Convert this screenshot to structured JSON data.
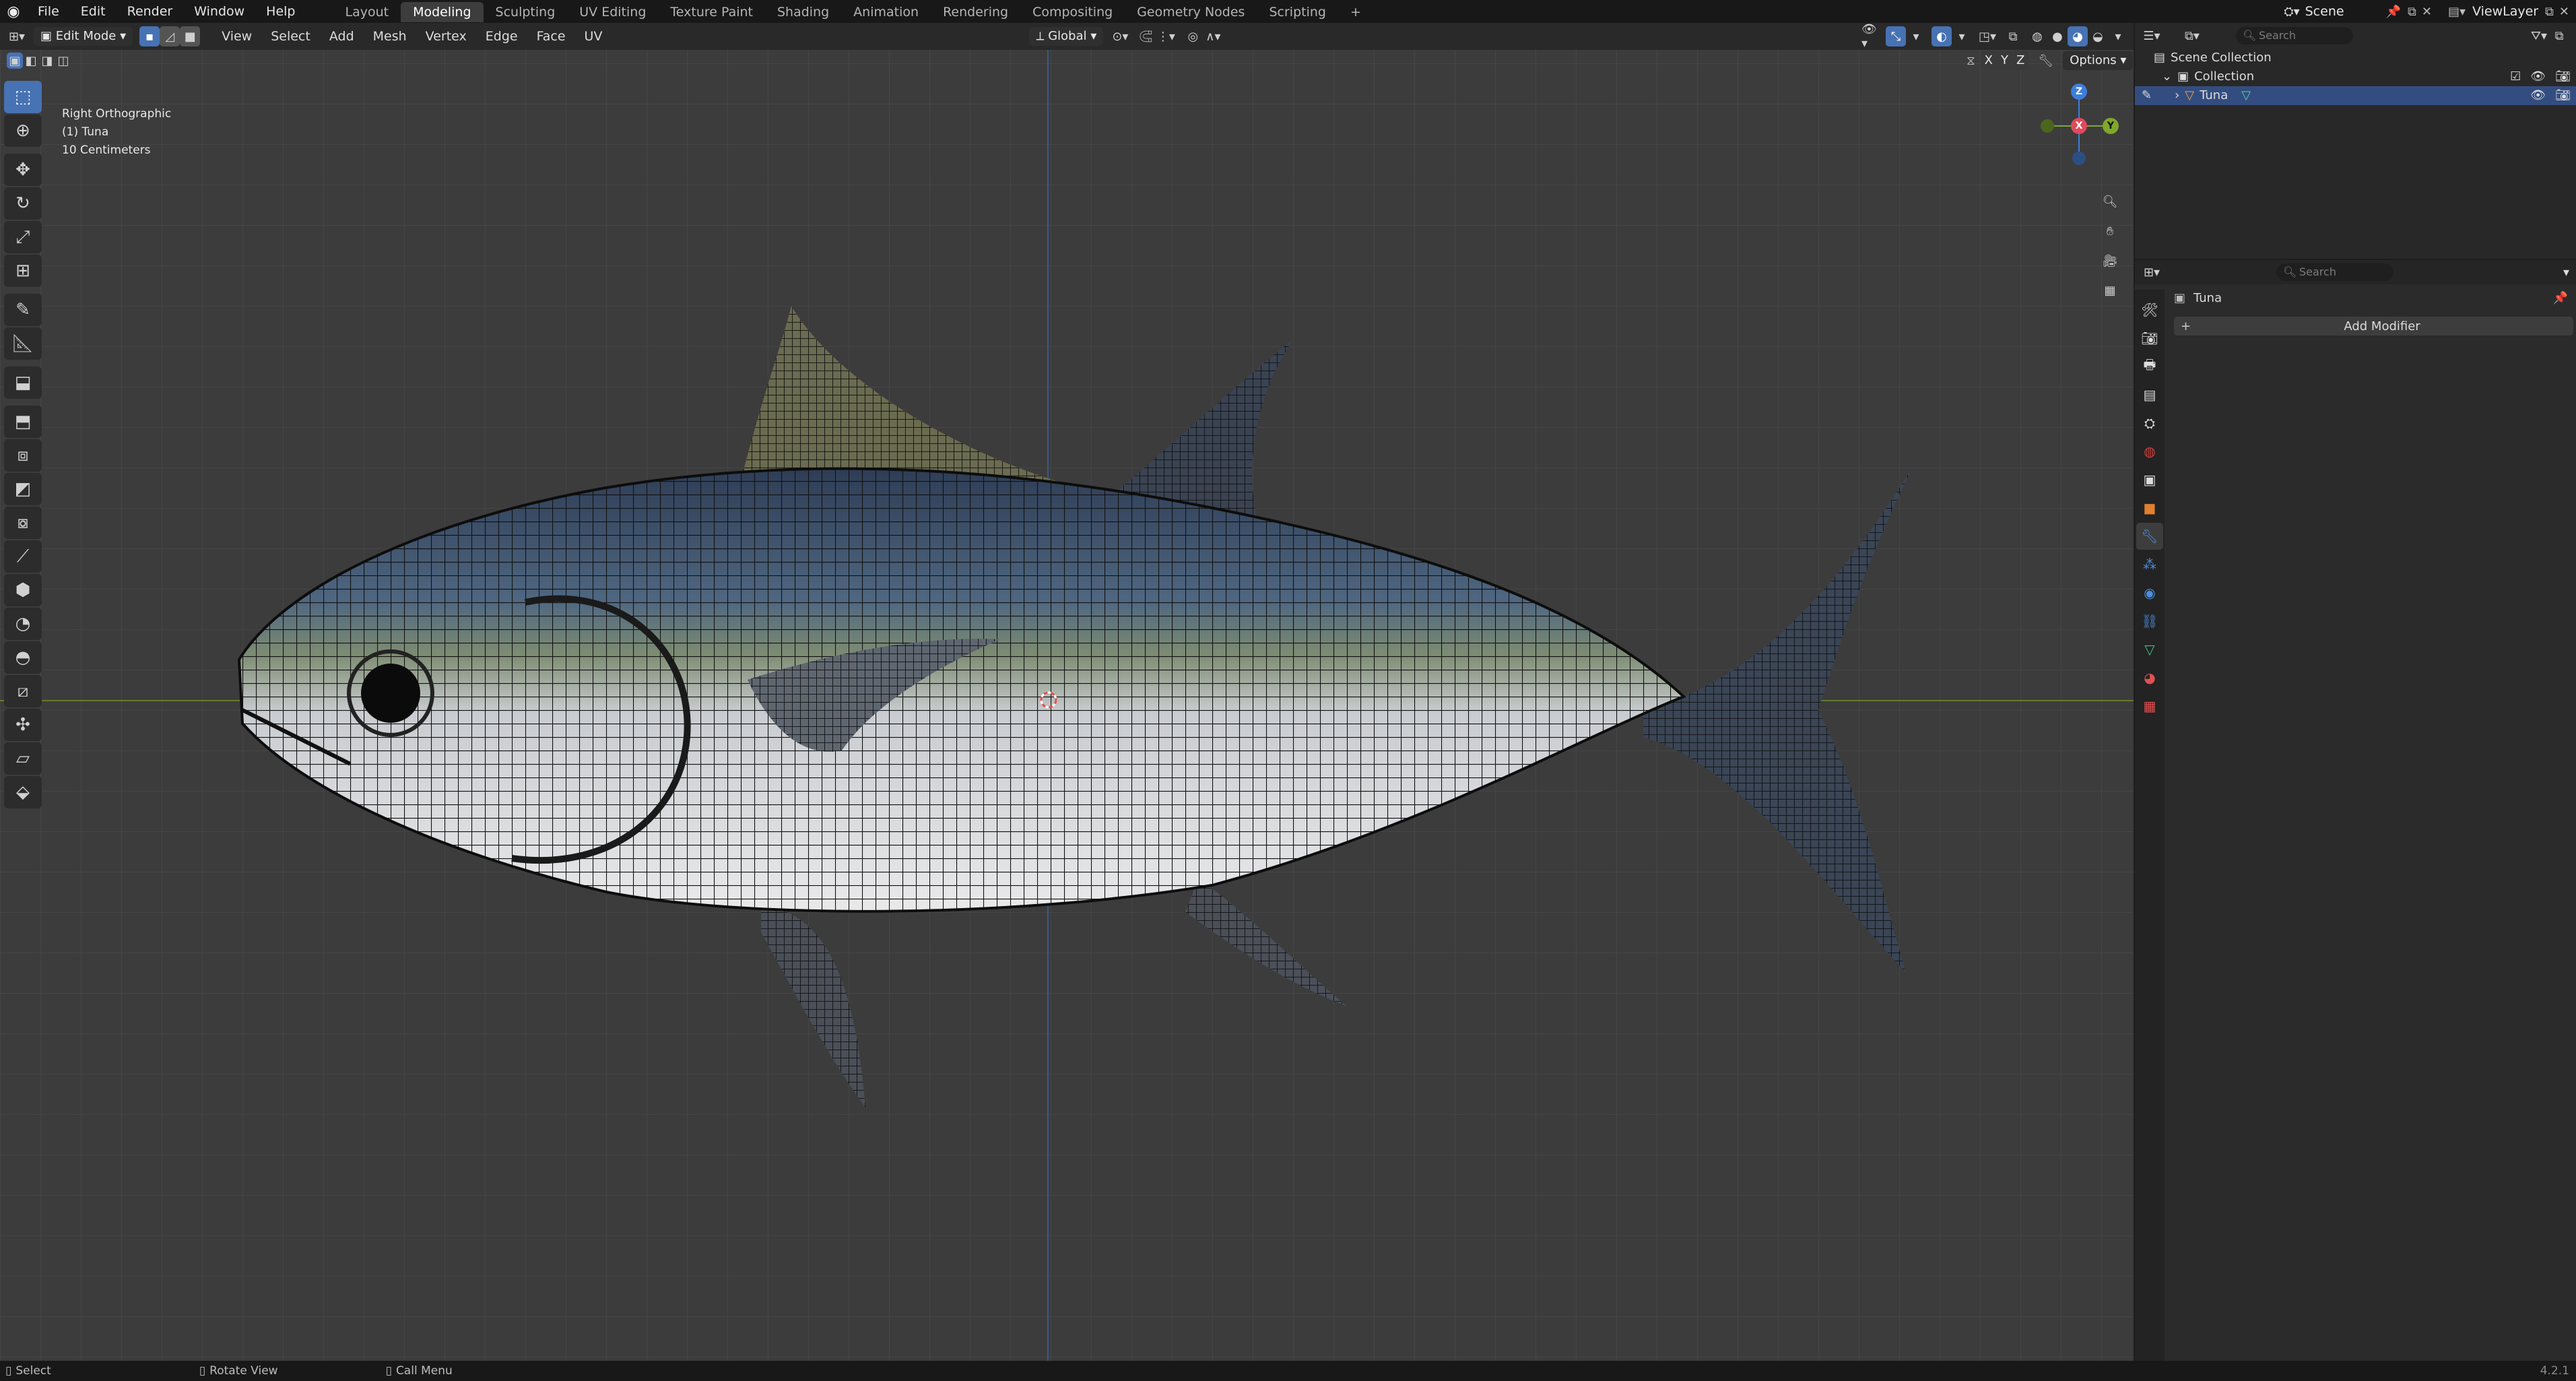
{
  "menus": [
    "File",
    "Edit",
    "Render",
    "Window",
    "Help"
  ],
  "workspaces": [
    "Layout",
    "Modeling",
    "Sculpting",
    "UV Editing",
    "Texture Paint",
    "Shading",
    "Animation",
    "Rendering",
    "Compositing",
    "Geometry Nodes",
    "Scripting"
  ],
  "active_workspace": "Modeling",
  "scene": "Scene",
  "view_layer": "ViewLayer",
  "header": {
    "mode": "Edit Mode",
    "menus": [
      "View",
      "Select",
      "Add",
      "Mesh",
      "Vertex",
      "Edge",
      "Face",
      "UV"
    ],
    "transform_orientation": "Global",
    "options": "Options",
    "axes": [
      "X",
      "Y",
      "Z"
    ]
  },
  "viewport_info": {
    "view": "Right Orthographic",
    "object": "(1) Tuna",
    "scale": "10 Centimeters"
  },
  "gizmo": {
    "z": "Z",
    "x": "X",
    "y": "Y"
  },
  "outliner": {
    "search_placeholder": "Search",
    "scene_collection": "Scene Collection",
    "collection": "Collection",
    "object": "Tuna"
  },
  "properties": {
    "search_placeholder": "Search",
    "object_name": "Tuna",
    "add_modifier": "Add Modifier"
  },
  "status": {
    "select": "Select",
    "rotate": "Rotate View",
    "call_menu": "Call Menu",
    "version": "4.2.1"
  },
  "colors": {
    "accent": "#4772b3",
    "axis_x": "#e04a5a",
    "axis_y": "#7ea82b",
    "axis_z": "#3d7ddc"
  }
}
